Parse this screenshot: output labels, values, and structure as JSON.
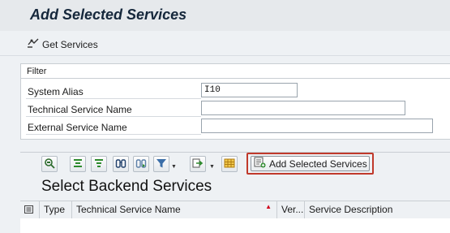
{
  "header": {
    "title": "Add Selected Services"
  },
  "toolbar": {
    "get_services_label": "Get Services",
    "get_services_icon": "get-services-icon"
  },
  "filter": {
    "legend": "Filter",
    "fields": [
      {
        "label": "System Alias",
        "value": "I10"
      },
      {
        "label": "Technical Service Name",
        "value": ""
      },
      {
        "label": "External Service Name",
        "value": ""
      }
    ]
  },
  "grid_toolbar": {
    "icons": [
      "details-icon",
      "sort-ascending-icon",
      "filter-icon",
      "find-icon",
      "find-next-icon",
      "set-filter-icon",
      "export-icon",
      "layout-icon"
    ],
    "add_selected_label": "Add Selected Services"
  },
  "section": {
    "title": "Select Backend Services"
  },
  "table": {
    "columns": [
      "Type",
      "Technical Service Name",
      "Ver...",
      "Service Description"
    ]
  },
  "colors": {
    "highlight": "#c0392b",
    "sort_marker": "#d0021b"
  }
}
